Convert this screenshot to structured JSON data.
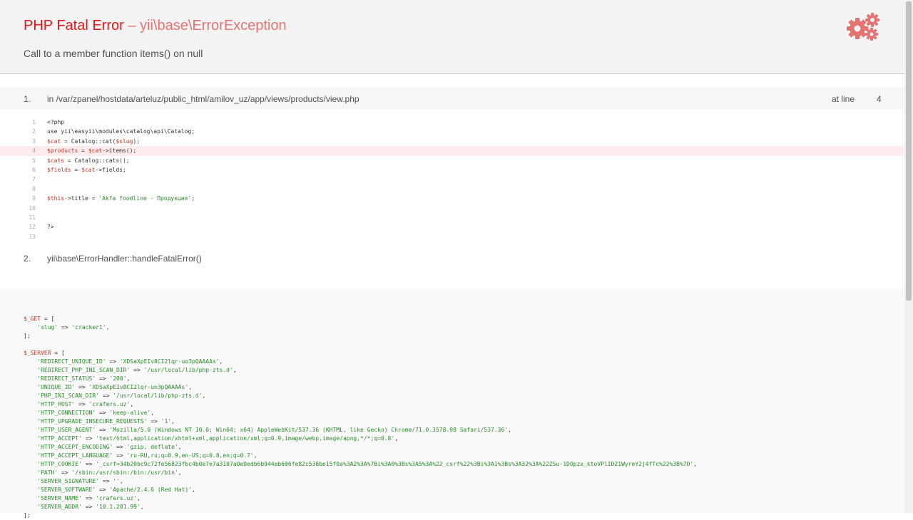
{
  "header": {
    "title_main": "PHP Fatal Error",
    "title_sep": " – ",
    "title_sub": "yii\\base\\ErrorException",
    "message": "Call to a member function items() on null",
    "icon": "gears-icon",
    "accent_color": "#e51717",
    "icon_color": "#e57373"
  },
  "trace": [
    {
      "number": "1.",
      "text": "in /var/zpanel/hostdata/arteluz/public_html/amilov_uz/app/views/products/view.php",
      "at_line_label": "at line",
      "line": "4"
    },
    {
      "number": "2.",
      "text": "yii\\base\\ErrorHandler::handleFatalError()"
    }
  ],
  "code": {
    "lines": [
      {
        "n": "1",
        "t": "<?php"
      },
      {
        "n": "2",
        "t": "use yii\\easyii\\modules\\catalog\\api\\Catalog;"
      },
      {
        "n": "3",
        "t": "$cat = Catalog::cat($slug);"
      },
      {
        "n": "4",
        "t": "$products = $cat->items();"
      },
      {
        "n": "5",
        "t": "$cats = Catalog::cats();"
      },
      {
        "n": "6",
        "t": "$fields = $cat->fields;"
      },
      {
        "n": "7",
        "t": ""
      },
      {
        "n": "8",
        "t": ""
      },
      {
        "n": "9",
        "t": "$this->title = 'Akfa foodline - Продукция';"
      },
      {
        "n": "10",
        "t": ""
      },
      {
        "n": "11",
        "t": ""
      },
      {
        "n": "12",
        "t": "?>"
      },
      {
        "n": "13",
        "t": ""
      }
    ],
    "error_line": "4",
    "highlight_color": "#ffebeb"
  },
  "request": {
    "get_var": "$_GET",
    "get_items": [
      {
        "k": "slug",
        "v": "cracker1"
      }
    ],
    "server_var": "$_SERVER",
    "server_items": [
      {
        "k": "REDIRECT_UNIQUE_ID",
        "v": "XDSaXpEIv8CI2lqr-uo3pQAAAAs"
      },
      {
        "k": "REDIRECT_PHP_INI_SCAN_DIR",
        "v": "/usr/local/lib/php-zts.d"
      },
      {
        "k": "REDIRECT_STATUS",
        "v": "200"
      },
      {
        "k": "UNIQUE_ID",
        "v": "XDSaXpEIv8CI2lqr-uo3pQAAAAs"
      },
      {
        "k": "PHP_INI_SCAN_DIR",
        "v": "/usr/local/lib/php-zts.d"
      },
      {
        "k": "HTTP_HOST",
        "v": "crafers.uz"
      },
      {
        "k": "HTTP_CONNECTION",
        "v": "keep-alive"
      },
      {
        "k": "HTTP_UPGRADE_INSECURE_REQUESTS",
        "v": "1"
      },
      {
        "k": "HTTP_USER_AGENT",
        "v": "Mozilla/5.0 (Windows NT 10.0; Win64; x64) AppleWebKit/537.36 (KHTML, like Gecko) Chrome/71.0.3578.98 Safari/537.36"
      },
      {
        "k": "HTTP_ACCEPT",
        "v": "text/html,application/xhtml+xml,application/xml;q=0.9,image/webp,image/apng,*/*;q=0.8"
      },
      {
        "k": "HTTP_ACCEPT_ENCODING",
        "v": "gzip, deflate"
      },
      {
        "k": "HTTP_ACCEPT_LANGUAGE",
        "v": "ru-RU,ru;q=0.9,en-US;q=0.8,en;q=0.7"
      },
      {
        "k": "HTTP_COOKIE",
        "v": "_csrf=34b20bc9c72fe56823fbc4b0e7e7a3107a0e0edb6b944eb606fe82c538be15f0a%3A2%3A%7Bi%3A0%3Bs%3A5%3A%22_csrf%22%3Bi%3A1%3Bs%3A32%3A%22ZSu-1DOpzx_ktoVPlID21WyreY2j4fTc%22%3B%7D"
      },
      {
        "k": "PATH",
        "v": "/sbin:/usr/sbin:/bin:/usr/bin"
      },
      {
        "k": "SERVER_SIGNATURE",
        "v": ""
      },
      {
        "k": "SERVER_SOFTWARE",
        "v": "Apache/2.4.6 (Red Hat)"
      },
      {
        "k": "SERVER_NAME",
        "v": "crafers.uz"
      },
      {
        "k": "SERVER_ADDR",
        "v": "10.1.201.99"
      }
    ]
  }
}
